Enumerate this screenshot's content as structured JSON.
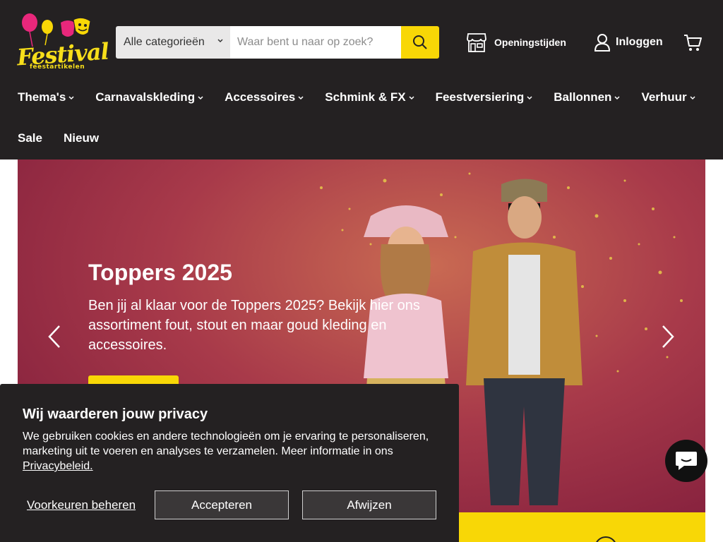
{
  "header": {
    "logo": {
      "text": "Festival",
      "subtext": "feestartikelen"
    },
    "search": {
      "category": "Alle categorieën",
      "placeholder": "Waar bent u naar op zoek?"
    },
    "store_hours": "Openingstijden",
    "login": "Inloggen"
  },
  "nav": {
    "row1": [
      "Thema's",
      "Carnavalskleding",
      "Accessoires",
      "Schmink & FX",
      "Feestversiering",
      "Ballonnen",
      "Verhuur"
    ],
    "row2": [
      "Sale",
      "Nieuw"
    ]
  },
  "hero": {
    "title": "Toppers 2025",
    "text": "Ben jij al klaar voor de Toppers 2025? Bekijk hier ons assortiment fout, stout en maar goud kleding en accessoires."
  },
  "cookie": {
    "title": "Wij waarderen jouw privacy",
    "body": "We gebruiken cookies en andere technologieën om je ervaring te personaliseren, marketing uit te voeren en analyses te verzamelen. Meer informatie in ons ",
    "link": "Privacybeleid.",
    "preferences": "Voorkeuren beheren",
    "accept": "Accepteren",
    "reject": "Afwijzen"
  },
  "colors": {
    "header_bg": "#242122",
    "accent_yellow": "#f8d706",
    "hero_bg": "#a83a4a"
  },
  "icons": [
    "balloon-icon",
    "theatre-masks-icon",
    "chevron-down-icon",
    "search-icon",
    "store-icon",
    "user-icon",
    "cart-icon",
    "chevron-left-icon",
    "chevron-right-icon",
    "chat-icon"
  ]
}
